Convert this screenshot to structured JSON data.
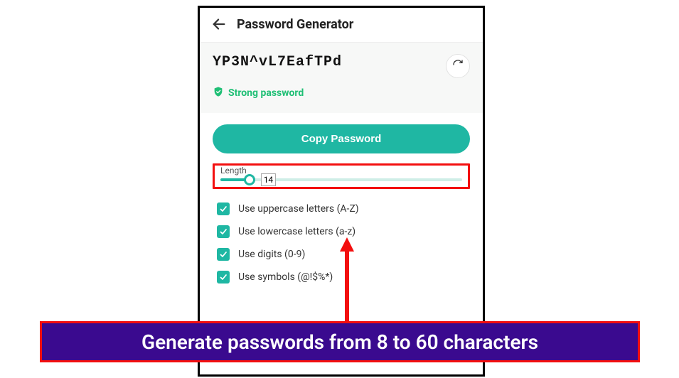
{
  "header": {
    "title": "Password Generator"
  },
  "password": {
    "value": "YP3N^vL7EafTPd",
    "strength_label": "Strong password"
  },
  "actions": {
    "copy_label": "Copy Password"
  },
  "length": {
    "label": "Length",
    "value": "14"
  },
  "options": [
    {
      "label": "Use uppercase letters (A-Z)",
      "checked": true
    },
    {
      "label": "Use lowercase letters (a-z)",
      "checked": true
    },
    {
      "label": "Use digits (0-9)",
      "checked": true
    },
    {
      "label": "Use symbols (@!$%*)",
      "checked": true
    }
  ],
  "annotation": {
    "caption": "Generate passwords from 8 to 60 characters"
  }
}
